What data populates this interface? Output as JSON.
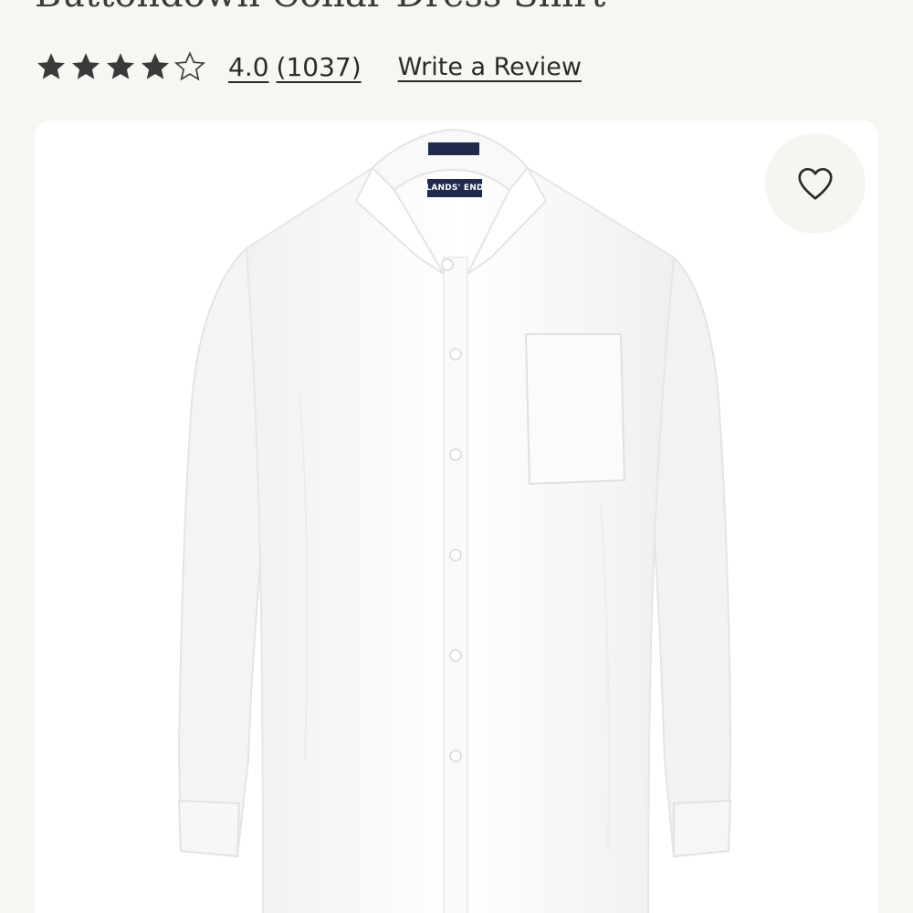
{
  "product": {
    "title": "Buttondown Collar Dress Shirt",
    "brand_tag": "LANDS' END"
  },
  "rating": {
    "value": "4.0",
    "count": "(1037)",
    "stars_filled": 4,
    "stars_total": 5,
    "star_color": "#3a3a3a"
  },
  "actions": {
    "write_review": "Write a Review",
    "wishlist_icon": "heart-icon"
  },
  "colors": {
    "background": "#f8f6f3",
    "image_background": "#ffffff",
    "text": "#2b2b2b"
  }
}
